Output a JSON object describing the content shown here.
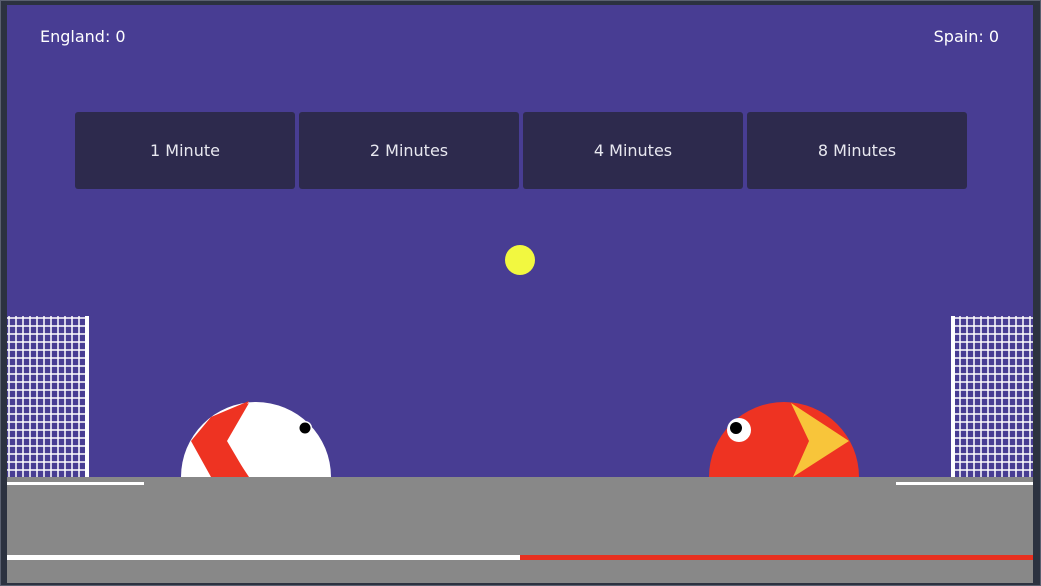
{
  "scoreboard": {
    "left": "England: 0",
    "right": "Spain: 0"
  },
  "durations": [
    "1 Minute",
    "2 Minutes",
    "4 Minutes",
    "8 Minutes"
  ],
  "timer": {
    "elapsed_fraction": 0.5
  },
  "colors": {
    "sky": "#483d93",
    "ground": "#888888",
    "button_bg": "#2d2a4d",
    "ball": "#f2f840",
    "england_body": "#ffffff",
    "england_beak": "#ee3322",
    "spain_body": "#ee3322",
    "spain_beak": "#f8c53a",
    "timer_left": "#ffffff",
    "timer_right": "#e8301f"
  }
}
